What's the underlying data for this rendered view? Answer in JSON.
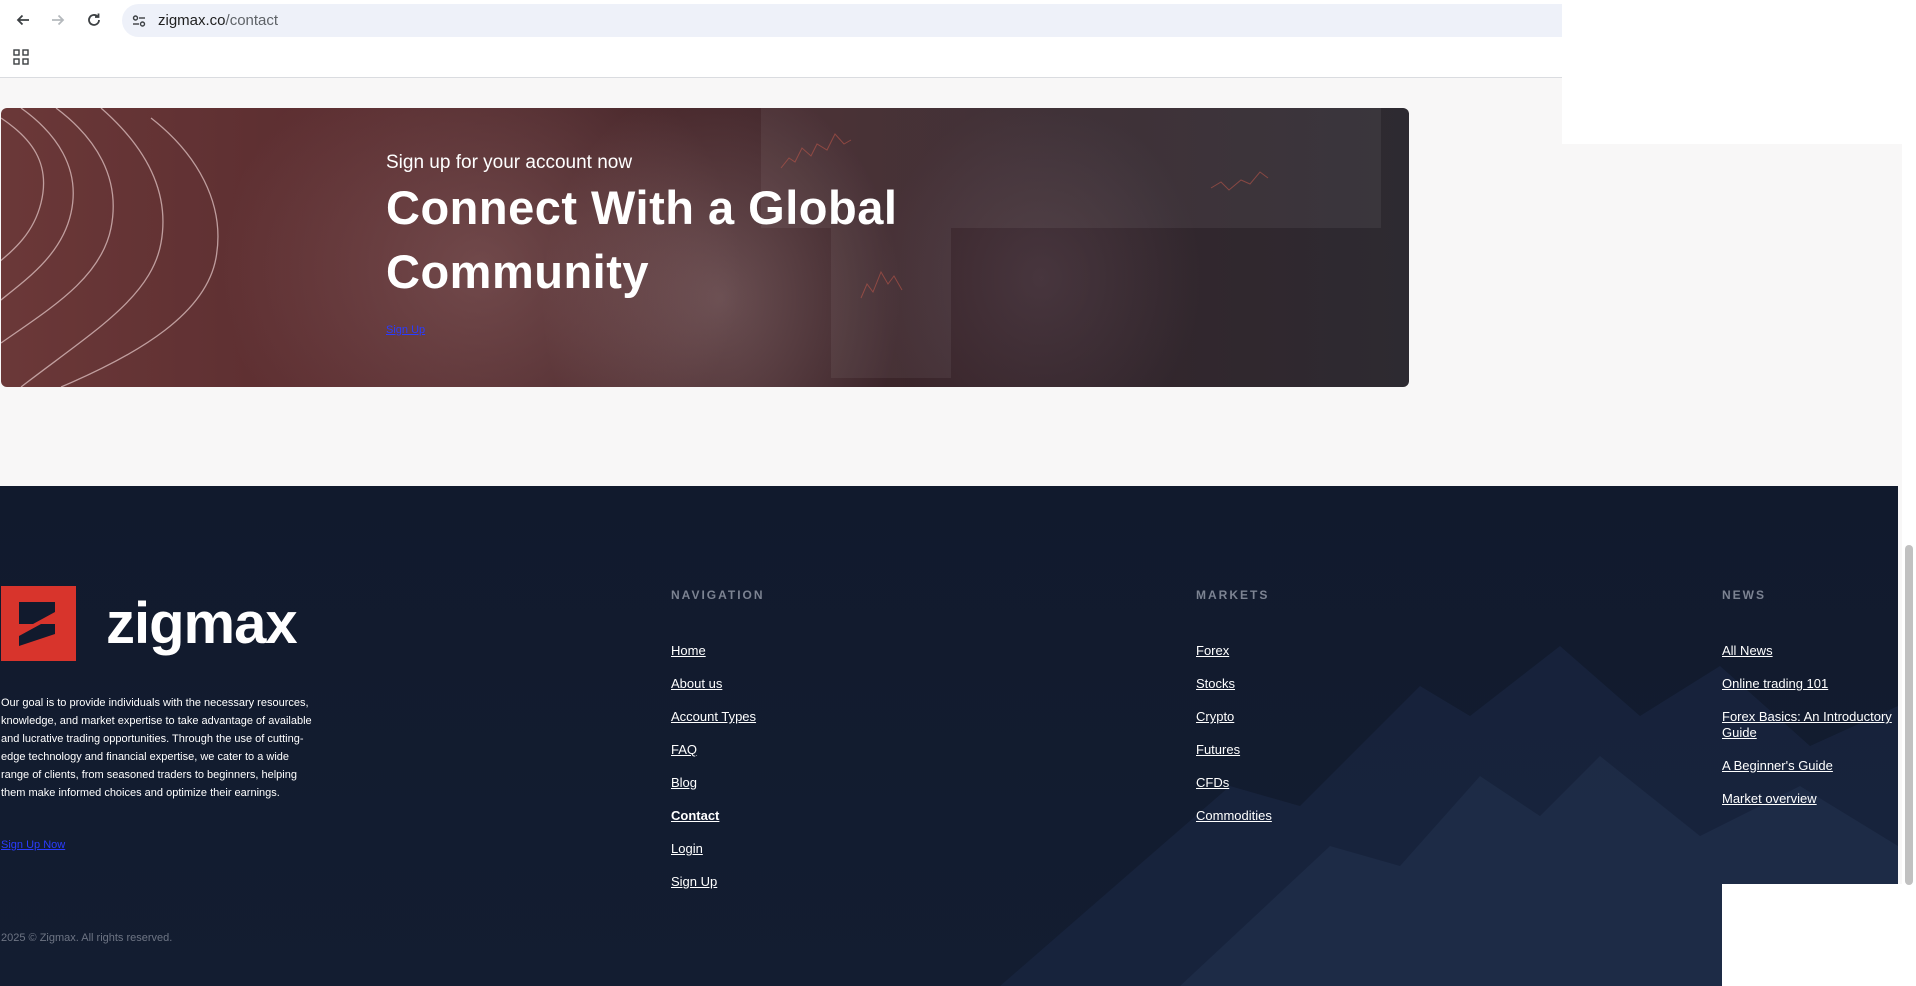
{
  "browser": {
    "url_domain": "zigmax.co",
    "url_path": "/contact",
    "back_icon": "back-arrow-icon",
    "forward_icon": "forward-arrow-icon",
    "reload_icon": "reload-icon",
    "site_info_icon": "site-info-icon",
    "apps_icon": "apps-grid-icon"
  },
  "banner": {
    "subtitle": "Sign up for your account now",
    "title": "Connect With a Global Community",
    "cta": "Sign Up"
  },
  "footer": {
    "brand": "zigmax",
    "brand_color": "#d8342c",
    "about": "Our goal is to provide individuals with the necessary resources, knowledge, and market expertise to take advantage of available and lucrative trading opportunities. Through the use of cutting-edge technology and financial expertise, we cater to a wide range of clients, from seasoned traders to beginners, helping them make informed choices and optimize their earnings.",
    "signup_now": "Sign Up Now",
    "copyright": "2025 © Zigmax. All rights reserved.",
    "navigation": {
      "heading": "NAVIGATION",
      "items": [
        "Home",
        "About us",
        "Account Types",
        "FAQ",
        "Blog",
        "Contact",
        "Login",
        "Sign Up"
      ]
    },
    "markets": {
      "heading": "MARKETS",
      "items": [
        "Forex",
        "Stocks",
        "Crypto",
        "Futures",
        "CFDs",
        "Commodities"
      ]
    },
    "news": {
      "heading": "NEWS",
      "items": [
        "All News",
        "Online trading 101",
        "Forex Basics: An Introductory Guide",
        "A Beginner's Guide",
        "Market overview"
      ]
    }
  }
}
